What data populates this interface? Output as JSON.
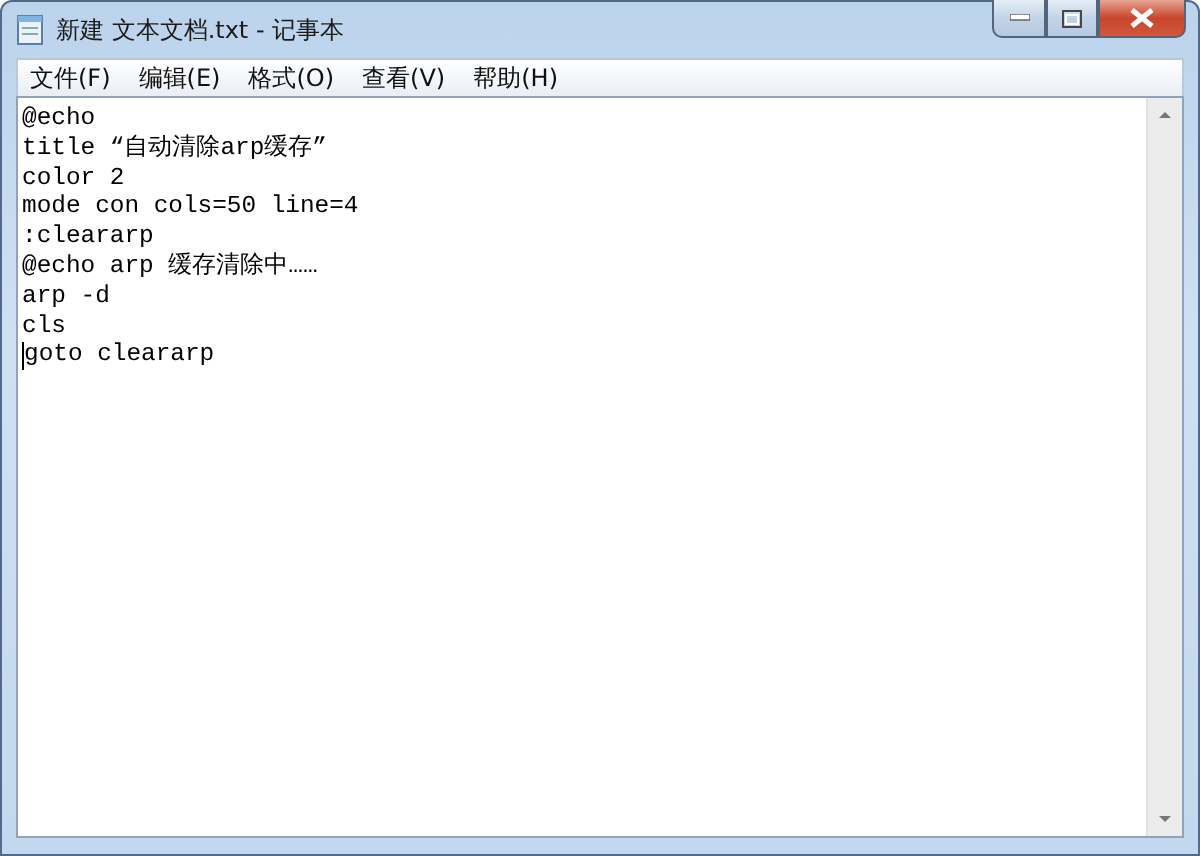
{
  "window": {
    "title": "新建 文本文档.txt - 记事本"
  },
  "menu": [
    "文件(F)",
    "编辑(E)",
    "格式(O)",
    "查看(V)",
    "帮助(H)"
  ],
  "editor": {
    "lines": [
      "@echo",
      "title “自动清除arp缓存”",
      "color 2",
      "mode con cols=50 line=4",
      ":cleararp",
      "@echo arp 缓存清除中……",
      "arp -d",
      "cls",
      "goto cleararp"
    ]
  }
}
